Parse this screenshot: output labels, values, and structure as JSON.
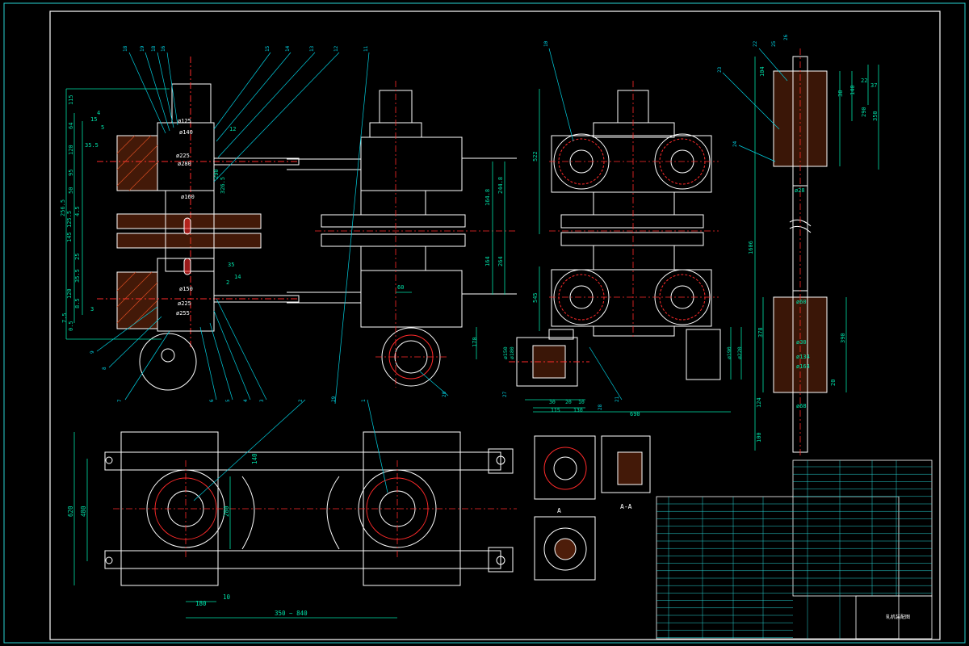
{
  "colors": {
    "background": "#000000",
    "outline": "#ffffff",
    "frame": "#27d3d3",
    "dimension": "#00e0a8",
    "leader": "#00cfe0",
    "centerline": "#ff2a2a",
    "hatch": "#d04820",
    "dot": "#ff2aff"
  },
  "left_section_dims": [
    "115",
    "64",
    "15",
    "4",
    "35.5",
    "120",
    "95",
    "290",
    "326.5",
    "50",
    "4.5",
    "125.5",
    "145",
    "256.5",
    "25",
    "35.5",
    "8.5",
    "120",
    "0.5",
    "7.5",
    "3",
    "2",
    "35",
    "14",
    "12",
    "5"
  ],
  "left_section_diameters": [
    "ø125",
    "ø140",
    "ø225",
    "ø280",
    "ø160",
    "ø225",
    "ø150",
    "ø255"
  ],
  "front_view_dims": [
    "60",
    "244.8",
    "164.8",
    "164",
    "264",
    "170"
  ],
  "right_view_dims": [
    "522",
    "545",
    "690"
  ],
  "detail_dims": [
    "ø150",
    "ø180",
    "ø190",
    "ø220",
    "30",
    "20",
    "10",
    "115",
    "130"
  ],
  "shaft_dims": [
    "104",
    "37",
    "22",
    "38",
    "140",
    "290",
    "350",
    "ø28",
    "1606",
    "ø60",
    "ø30",
    "ø134",
    "ø164",
    "ø68",
    "124",
    "20",
    "100",
    "378",
    "390"
  ],
  "plan_dims": [
    "620",
    "480",
    "280",
    "140",
    "180",
    "10",
    "350 ~ 840"
  ],
  "section_marks": [
    "A",
    "A-A"
  ],
  "balloon_labels": [
    "18",
    "19",
    "18",
    "16",
    "15",
    "14",
    "13",
    "12",
    "11",
    "10",
    "9",
    "8",
    "7",
    "6",
    "5",
    "4",
    "3",
    "2",
    "1",
    "20",
    "21",
    "22",
    "23",
    "24",
    "25",
    "26",
    "27",
    "28",
    "29"
  ],
  "title_block_title": "轧机装配图"
}
